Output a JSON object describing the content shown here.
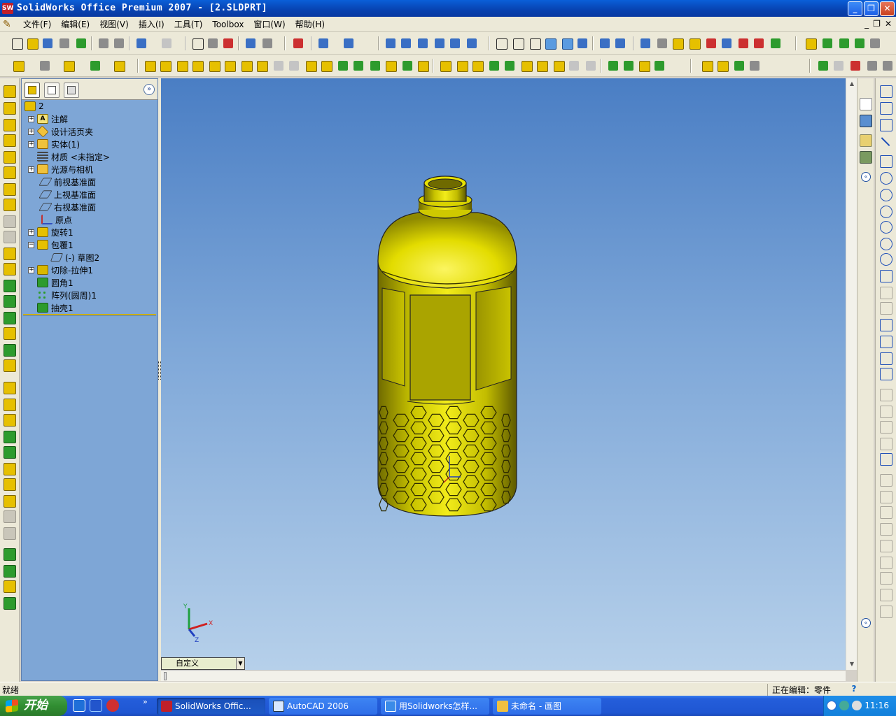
{
  "window": {
    "title": "SolidWorks Office Premium 2007 - [2.SLDPRT]",
    "app_icon": "SW",
    "controls": [
      "_",
      "❐",
      "✕"
    ]
  },
  "menu": {
    "items": [
      "文件(F)",
      "编辑(E)",
      "视图(V)",
      "插入(I)",
      "工具(T)",
      "Toolbox",
      "窗口(W)",
      "帮助(H)"
    ],
    "mdi_controls": [
      "_",
      "❐",
      "✕"
    ]
  },
  "feature_tree": {
    "root": "2",
    "nodes": [
      {
        "label": "注解",
        "icon": "annotation-icon",
        "expandable": true
      },
      {
        "label": "设计活页夹",
        "icon": "design-binder-icon",
        "expandable": true
      },
      {
        "label": "实体(1)",
        "icon": "solid-body-icon",
        "expandable": true
      },
      {
        "label": "材质 <未指定>",
        "icon": "material-icon",
        "expandable": false
      },
      {
        "label": "光源与相机",
        "icon": "lights-cameras-icon",
        "expandable": true
      },
      {
        "label": "前视基准面",
        "icon": "plane-icon",
        "expandable": false
      },
      {
        "label": "上视基准面",
        "icon": "plane-icon",
        "expandable": false
      },
      {
        "label": "右视基准面",
        "icon": "plane-icon",
        "expandable": false
      },
      {
        "label": "原点",
        "icon": "origin-icon",
        "expandable": false
      },
      {
        "label": "旋转1",
        "icon": "revolve-icon",
        "expandable": true
      },
      {
        "label": "包覆1",
        "icon": "wrap-icon",
        "expandable": true,
        "expanded": true
      },
      {
        "label": "(-) 草图2",
        "icon": "sketch-icon",
        "expandable": false,
        "child": true
      },
      {
        "label": "切除-拉伸1",
        "icon": "cut-extrude-icon",
        "expandable": true
      },
      {
        "label": "圆角1",
        "icon": "fillet-icon",
        "expandable": false
      },
      {
        "label": "阵列(圆周)1",
        "icon": "circular-pattern-icon",
        "expandable": false
      },
      {
        "label": "抽壳1",
        "icon": "shell-icon",
        "expandable": false
      }
    ]
  },
  "viewport": {
    "view_orientation": "自定义",
    "triad": {
      "x": "X",
      "y": "Y",
      "z": "Z"
    },
    "model_color": "#e6e000",
    "background_top": "#4a7ec4",
    "background_bottom": "#b6d0ea"
  },
  "status": {
    "left": "就绪",
    "right": "正在编辑：零件",
    "help": "?"
  },
  "taskbar": {
    "start": "开始",
    "quick_more": "»",
    "tasks": [
      {
        "label": "SolidWorks Offic...",
        "icon": "solidworks-icon",
        "active": true
      },
      {
        "label": "AutoCAD 2006",
        "icon": "autocad-icon",
        "active": false
      },
      {
        "label": "用Solidworks怎样...",
        "icon": "ie-icon",
        "active": false
      },
      {
        "label": "未命名 - 画图",
        "icon": "paint-icon",
        "active": false
      }
    ],
    "clock": "11:16"
  },
  "colors": {
    "title_bar": "#0842b0",
    "feature_tree_bg": "#7ea6d6",
    "rollback_bar": "#f0d000",
    "taskbar": "#245edb",
    "start_button": "#318e32"
  }
}
